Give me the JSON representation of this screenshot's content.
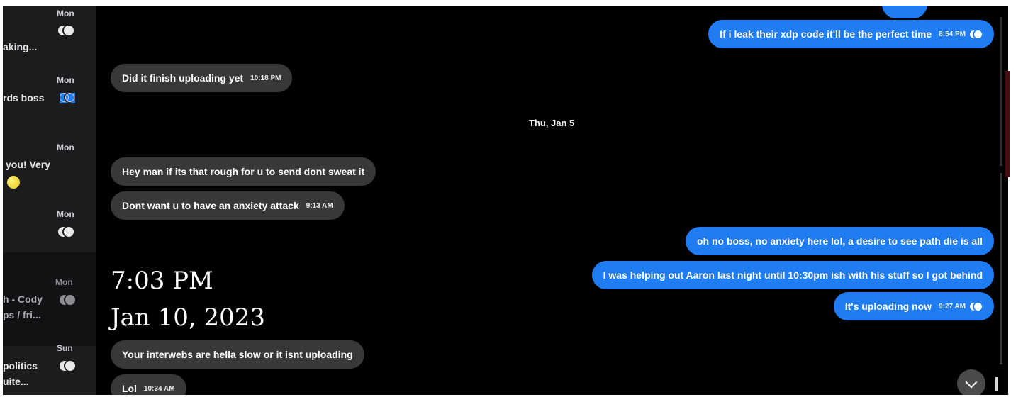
{
  "sidebar": {
    "items": [
      {
        "time": "Mon",
        "preview": "aking...",
        "preview2": ""
      },
      {
        "time": "Mon",
        "preview": "rds boss",
        "preview2": ""
      },
      {
        "time": "Mon",
        "preview": "you! Very",
        "preview2": ""
      },
      {
        "time": "Mon",
        "preview": "",
        "preview2": ""
      },
      {
        "time": "Mon",
        "preview": "h - Cody",
        "preview2": "ps / fri..."
      },
      {
        "time": "Sun",
        "preview": "politics",
        "preview2": "uite..."
      }
    ]
  },
  "chat": {
    "messages": [
      {
        "text": "If i leak their xdp code it'll be the perfect time",
        "time": "8:54 PM"
      },
      {
        "text": "Did it finish uploading yet",
        "time": "10:18 PM"
      },
      {
        "text": "Hey man if its that rough for u to send dont sweat it",
        "time": ""
      },
      {
        "text": "Dont want u to have an anxiety attack",
        "time": "9:13 AM"
      },
      {
        "text": "oh no boss, no anxiety here lol, a desire to see path die is all",
        "time": ""
      },
      {
        "text": "I was helping out Aaron last night until 10:30pm ish with his stuff so I got behind",
        "time": ""
      },
      {
        "text": "It's uploading now",
        "time": "9:27 AM"
      },
      {
        "text": "Your interwebs are hella slow or it isnt uploading",
        "time": ""
      },
      {
        "text": "Lol",
        "time": "10:34 AM"
      }
    ],
    "date_separator": "Thu, Jan 5"
  },
  "overlay": {
    "time": "7:03 PM",
    "date": "Jan 10, 2023"
  },
  "icons": {
    "read_receipt": "read-receipt-icon",
    "scroll_down": "chevron-down-icon"
  },
  "colors": {
    "outgoing": "#1f7cf2",
    "incoming": "#38383b",
    "background": "#000000"
  }
}
